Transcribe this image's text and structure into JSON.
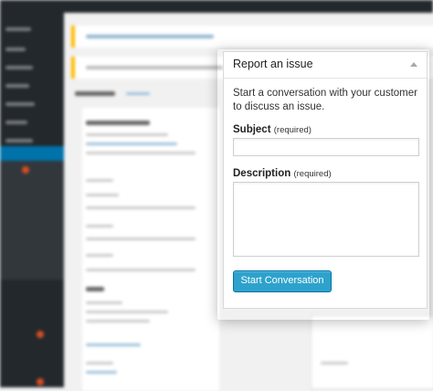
{
  "popup": {
    "title": "Report an issue",
    "intro": "Start a conversation with your customer to discuss an issue.",
    "subject_label": "Subject",
    "subject_required": "(required)",
    "subject_value": "",
    "description_label": "Description",
    "description_required": "(required)",
    "description_value": "",
    "start_button": "Start Conversation"
  },
  "colors": {
    "accent": "#2ea2cc",
    "admin_bar": "#23282d",
    "active_menu": "#0073aa",
    "notice_border": "#ffba00"
  },
  "icons": {
    "collapse": "caret-up-icon"
  }
}
